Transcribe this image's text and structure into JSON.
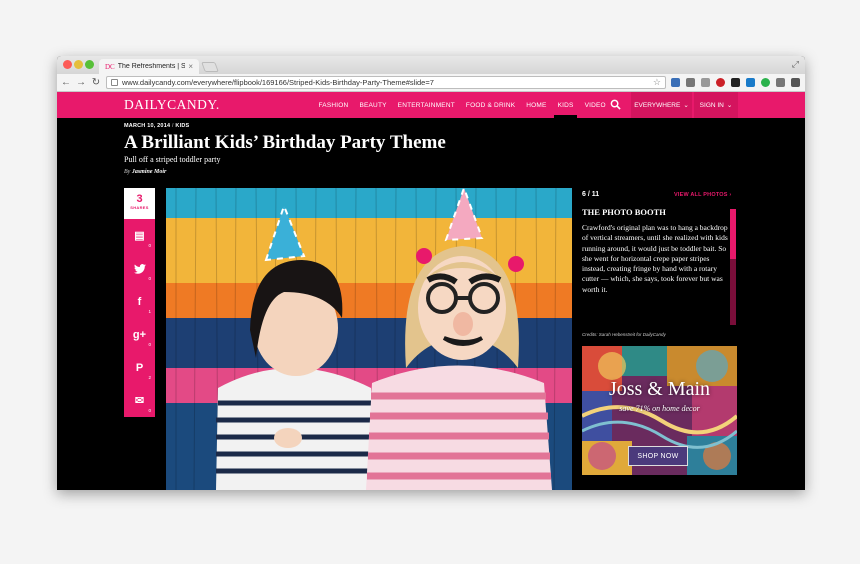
{
  "browser": {
    "tab_title": "The Refreshments | Stripe",
    "tab_favicon": "DC",
    "tab_close": "×",
    "url": "www.dailycandy.com/everywhere/flipbook/169166/Striped-Kids-Birthday-Party-Theme#slide=7"
  },
  "site": {
    "logo": "DAILYCANDY.",
    "nav": [
      "FASHION",
      "BEAUTY",
      "ENTERTAINMENT",
      "FOOD & DRINK",
      "HOME",
      "KIDS",
      "VIDEO"
    ],
    "active_nav": "KIDS",
    "everywhere": "EVERYWHERE",
    "signin": "SIGN IN",
    "brand_color": "#e8196b"
  },
  "article": {
    "date": "MARCH 10, 2014",
    "section": "KIDS",
    "title": "A Brilliant Kids’ Birthday Party Theme",
    "subtitle": "Pull off a striped toddler party",
    "byline_prefix": "By",
    "author": "Jasmine Moir"
  },
  "share": {
    "count": "3",
    "label": "SHARES",
    "buttons": [
      {
        "icon": "bookmark-add-icon",
        "glyph": "▤",
        "count": "0"
      },
      {
        "icon": "twitter-icon",
        "glyph": "🐦",
        "count": "0"
      },
      {
        "icon": "facebook-icon",
        "glyph": "f",
        "count": "1"
      },
      {
        "icon": "google-plus-icon",
        "glyph": "g+",
        "count": "0"
      },
      {
        "icon": "pinterest-icon",
        "glyph": "P",
        "count": "2"
      },
      {
        "icon": "email-icon",
        "glyph": "✉",
        "count": "0"
      }
    ]
  },
  "slideshow": {
    "position": "6 / 11",
    "view_all": "VIEW ALL PHOTOS",
    "caption_title": "THE PHOTO BOOTH",
    "caption_text": "Crawford's original plan was to hang a backdrop of vertical streamers, until she realized with kids running around, it would just be toddler bait. So she went for horizontal crepe paper stripes instead, creating fringe by hand with a rotary cutter — which, she says, took forever but was worth it.",
    "credit": "Credits: Sarah Hebenstreit for DailyCandy"
  },
  "ad": {
    "brand": "Joss & Main",
    "tagline": "save 71% on home decor",
    "cta": "SHOP NOW"
  }
}
